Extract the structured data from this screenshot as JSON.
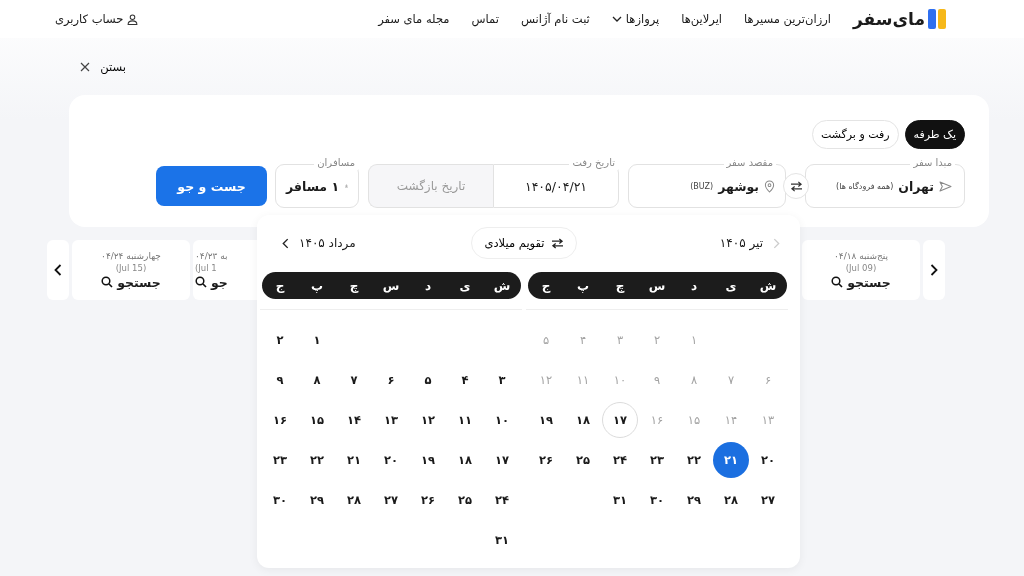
{
  "header": {
    "logo": "مای‌سفر",
    "nav": [
      {
        "label": "ارزان‌ترین مسیرها",
        "dropdown": false
      },
      {
        "label": "ایرلاین‌ها",
        "dropdown": false
      },
      {
        "label": "پروازها",
        "dropdown": true
      },
      {
        "label": "ثبت نام آژانس",
        "dropdown": false
      },
      {
        "label": "تماس",
        "dropdown": false
      },
      {
        "label": "مجله مای سفر",
        "dropdown": false
      }
    ],
    "account": "حساب کاربری"
  },
  "close": "بستن",
  "search": {
    "trip_types": [
      {
        "label": "یک طرفه",
        "selected": true
      },
      {
        "label": "رفت و برگشت",
        "selected": false
      }
    ],
    "origin": {
      "label": "مبدا سفر",
      "value": "تهران",
      "note": "(همه فرودگاه ها)"
    },
    "destination": {
      "label": "مقصد سفر",
      "value": "بوشهر",
      "note": "(BUZ)"
    },
    "depart": {
      "label": "تاریخ رفت",
      "value": "۱۴۰۵/۰۴/۲۱"
    },
    "return": {
      "placeholder": "تاریخ بازگشت",
      "disabled": true
    },
    "passengers": {
      "label": "مسافران",
      "value": "۱ مسافر"
    },
    "submit": "جست و جو"
  },
  "date_strip": [
    {
      "day": "پنج‌شنبه ۰۴/۱۸",
      "gregorian": "(Jul 09)",
      "action": "جستجو"
    },
    {
      "day": "به ۰۴/۲۳",
      "gregorian": "(Jul 1",
      "action": "جو"
    },
    {
      "day": "چهارشنبه ۰۴/۲۴",
      "gregorian": "(Jul 15)",
      "action": "جستجو"
    }
  ],
  "calendar": {
    "toggle": "تقویم میلادی",
    "months": [
      {
        "title": "تیر ۱۴۰۵",
        "weekdays": [
          "ش",
          "ی",
          "د",
          "س",
          "چ",
          "پ",
          "ج"
        ],
        "weeks": [
          [
            {
              "d": "۱",
              "disabled": true,
              "today": false,
              "selected": false
            },
            {
              "d": "۲",
              "disabled": true,
              "today": false,
              "selected": false
            },
            {
              "d": "۳",
              "disabled": true,
              "today": false,
              "selected": false
            },
            {
              "d": "۴",
              "disabled": true,
              "today": false,
              "selected": false
            },
            {
              "d": "۵",
              "disabled": true,
              "today": false,
              "selected": false
            }
          ],
          [
            {
              "d": "۶",
              "disabled": true,
              "today": false,
              "selected": false
            },
            {
              "d": "۷",
              "disabled": true,
              "today": false,
              "selected": false
            },
            {
              "d": "۸",
              "disabled": true,
              "today": false,
              "selected": false
            },
            {
              "d": "۹",
              "disabled": true,
              "today": false,
              "selected": false
            },
            {
              "d": "۱۰",
              "disabled": true,
              "today": false,
              "selected": false
            },
            {
              "d": "۱۱",
              "disabled": true,
              "today": false,
              "selected": false
            },
            {
              "d": "۱۲",
              "disabled": true,
              "today": false,
              "selected": false
            }
          ],
          [
            {
              "d": "۱۳",
              "disabled": true,
              "today": false,
              "selected": false
            },
            {
              "d": "۱۴",
              "disabled": true,
              "today": false,
              "selected": false
            },
            {
              "d": "۱۵",
              "disabled": true,
              "today": false,
              "selected": false
            },
            {
              "d": "۱۶",
              "disabled": true,
              "today": false,
              "selected": false
            },
            {
              "d": "۱۷",
              "disabled": false,
              "today": true,
              "selected": false
            },
            {
              "d": "۱۸",
              "disabled": false,
              "today": false,
              "selected": false
            },
            {
              "d": "۱۹",
              "disabled": false,
              "today": false,
              "selected": false
            }
          ],
          [
            {
              "d": "۲۰",
              "disabled": false,
              "today": false,
              "selected": false
            },
            {
              "d": "۲۱",
              "disabled": false,
              "today": false,
              "selected": true
            },
            {
              "d": "۲۲",
              "disabled": false,
              "today": false,
              "selected": false
            },
            {
              "d": "۲۳",
              "disabled": false,
              "today": false,
              "selected": false
            },
            {
              "d": "۲۴",
              "disabled": false,
              "today": false,
              "selected": false
            },
            {
              "d": "۲۵",
              "disabled": false,
              "today": false,
              "selected": false
            },
            {
              "d": "۲۶",
              "disabled": false,
              "today": false,
              "selected": false
            }
          ],
          [
            {
              "d": "۲۷",
              "disabled": false,
              "today": false,
              "selected": false
            },
            {
              "d": "۲۸",
              "disabled": false,
              "today": false,
              "selected": false
            },
            {
              "d": "۲۹",
              "disabled": false,
              "today": false,
              "selected": false
            },
            {
              "d": "۳۰",
              "disabled": false,
              "today": false,
              "selected": false
            },
            {
              "d": "۳۱",
              "disabled": false,
              "today": false,
              "selected": false
            }
          ]
        ]
      },
      {
        "title": "مرداد ۱۴۰۵",
        "weekdays": [
          "ش",
          "ی",
          "د",
          "س",
          "چ",
          "پ",
          "ج"
        ],
        "weeks": [
          [
            {
              "d": "۱",
              "disabled": false,
              "today": false,
              "selected": false
            },
            {
              "d": "۲",
              "disabled": false,
              "today": false,
              "selected": false
            }
          ],
          [
            {
              "d": "۳",
              "disabled": false,
              "today": false,
              "selected": false
            },
            {
              "d": "۴",
              "disabled": false,
              "today": false,
              "selected": false
            },
            {
              "d": "۵",
              "disabled": false,
              "today": false,
              "selected": false
            },
            {
              "d": "۶",
              "disabled": false,
              "today": false,
              "selected": false
            },
            {
              "d": "۷",
              "disabled": false,
              "today": false,
              "selected": false
            },
            {
              "d": "۸",
              "disabled": false,
              "today": false,
              "selected": false
            },
            {
              "d": "۹",
              "disabled": false,
              "today": false,
              "selected": false
            }
          ],
          [
            {
              "d": "۱۰",
              "disabled": false,
              "today": false,
              "selected": false
            },
            {
              "d": "۱۱",
              "disabled": false,
              "today": false,
              "selected": false
            },
            {
              "d": "۱۲",
              "disabled": false,
              "today": false,
              "selected": false
            },
            {
              "d": "۱۳",
              "disabled": false,
              "today": false,
              "selected": false
            },
            {
              "d": "۱۴",
              "disabled": false,
              "today": false,
              "selected": false
            },
            {
              "d": "۱۵",
              "disabled": false,
              "today": false,
              "selected": false
            },
            {
              "d": "۱۶",
              "disabled": false,
              "today": false,
              "selected": false
            }
          ],
          [
            {
              "d": "۱۷",
              "disabled": false,
              "today": false,
              "selected": false
            },
            {
              "d": "۱۸",
              "disabled": false,
              "today": false,
              "selected": false
            },
            {
              "d": "۱۹",
              "disabled": false,
              "today": false,
              "selected": false
            },
            {
              "d": "۲۰",
              "disabled": false,
              "today": false,
              "selected": false
            },
            {
              "d": "۲۱",
              "disabled": false,
              "today": false,
              "selected": false
            },
            {
              "d": "۲۲",
              "disabled": false,
              "today": false,
              "selected": false
            },
            {
              "d": "۲۳",
              "disabled": false,
              "today": false,
              "selected": false
            }
          ],
          [
            {
              "d": "۲۴",
              "disabled": false,
              "today": false,
              "selected": false
            },
            {
              "d": "۲۵",
              "disabled": false,
              "today": false,
              "selected": false
            },
            {
              "d": "۲۶",
              "disabled": false,
              "today": false,
              "selected": false
            },
            {
              "d": "۲۷",
              "disabled": false,
              "today": false,
              "selected": false
            },
            {
              "d": "۲۸",
              "disabled": false,
              "today": false,
              "selected": false
            },
            {
              "d": "۲۹",
              "disabled": false,
              "today": false,
              "selected": false
            },
            {
              "d": "۳۰",
              "disabled": false,
              "today": false,
              "selected": false
            }
          ],
          [
            {
              "d": "۳۱",
              "disabled": false,
              "today": false,
              "selected": false
            }
          ]
        ]
      }
    ]
  }
}
